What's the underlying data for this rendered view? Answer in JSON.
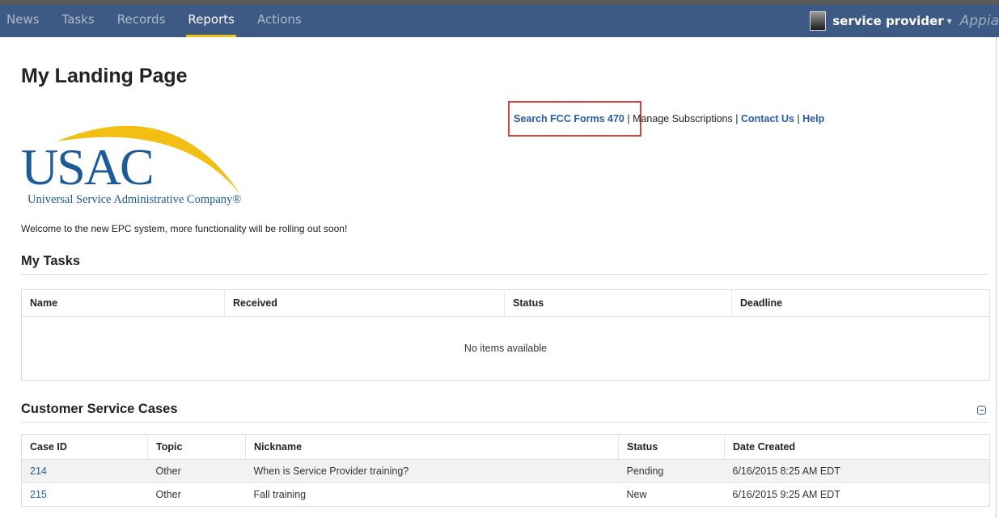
{
  "nav": {
    "items": [
      {
        "label": "News",
        "active": false
      },
      {
        "label": "Tasks",
        "active": false
      },
      {
        "label": "Records",
        "active": false
      },
      {
        "label": "Reports",
        "active": true
      },
      {
        "label": "Actions",
        "active": false
      }
    ],
    "user_name": "service provider",
    "caret": "▾",
    "brand": "Appia"
  },
  "page": {
    "title": "My Landing Page",
    "links": {
      "search_forms": "Search FCC Forms 470",
      "sep": " | ",
      "manage": "Manage Subscriptions",
      "contact": "Contact Us",
      "help": "Help"
    },
    "logo": {
      "text": "USAC",
      "subtitle": "Universal Service Administrative Company®"
    },
    "welcome": "Welcome to the new EPC system, more functionality will be rolling out soon!"
  },
  "tasks": {
    "title": "My Tasks",
    "columns": [
      "Name",
      "Received",
      "Status",
      "Deadline"
    ],
    "empty": "No items available"
  },
  "cases": {
    "title": "Customer Service Cases",
    "columns": [
      "Case ID",
      "Topic",
      "Nickname",
      "Status",
      "Date Created"
    ],
    "rows": [
      {
        "id": "214",
        "topic": "Other",
        "nickname": "When is Service Provider training?",
        "status": "Pending",
        "date": "6/16/2015 8:25 AM EDT"
      },
      {
        "id": "215",
        "topic": "Other",
        "nickname": "Fall training",
        "status": "New",
        "date": "6/16/2015 9:25 AM EDT"
      }
    ]
  },
  "colors": {
    "nav_bg": "#3d5a84",
    "active_underline": "#f3c31a",
    "link": "#2a5ba8",
    "highlight": "#d9443a",
    "logo_blue": "#1d5a98",
    "logo_arc": "#f2c014"
  }
}
